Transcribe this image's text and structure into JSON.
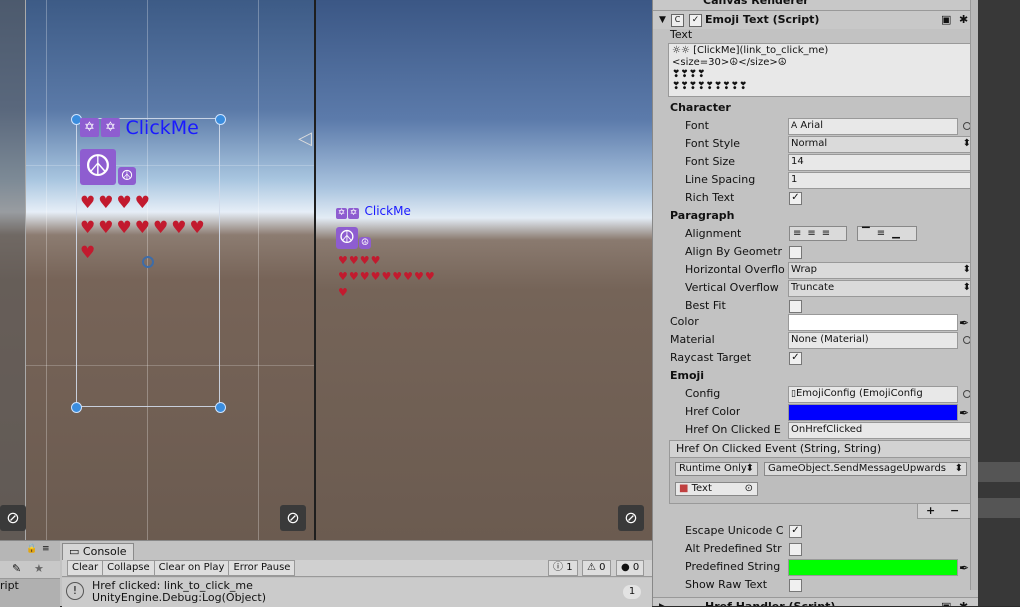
{
  "scene": {
    "click_me": "ClickMe",
    "star_glyph": "✡",
    "peace_glyph": "☮",
    "heart_rows": [
      "♥♥♥♥",
      "♥♥♥♥♥♥♥",
      "♥"
    ]
  },
  "game": {
    "click_me": "ClickMe",
    "star_glyph": "✡",
    "peace_glyph": "☮",
    "heart_rows": [
      "♥♥♥♥",
      "♥♥♥♥♥♥♥♥♥",
      "♥"
    ]
  },
  "console": {
    "tab_label": "Console",
    "script_label": "ript",
    "buttons": [
      "Clear",
      "Collapse",
      "Clear on Play",
      "Error Pause"
    ],
    "info_count": "1",
    "warn_count": "0",
    "error_count": "0",
    "log_line1": "Href clicked: link_to_click_me",
    "log_line2": "UnityEngine.Debug:Log(Object)",
    "log_count": "1"
  },
  "inspector": {
    "header_top": "Canvas Renderer",
    "component_title": "Emoji Text (Script)",
    "text_label": "Text",
    "text_lines": [
      "☼☼ [ClickMe](link_to_click_me)",
      "<size=30>☮</size>☮",
      "❣❣❣❣",
      "❣❣❣❣❣❣❣❣❣"
    ],
    "character_header": "Character",
    "font_label": "Font",
    "font_value": "Arial",
    "font_style_label": "Font Style",
    "font_style_value": "Normal",
    "font_size_label": "Font Size",
    "font_size_value": "14",
    "line_spacing_label": "Line Spacing",
    "line_spacing_value": "1",
    "rich_text_label": "Rich Text",
    "paragraph_header": "Paragraph",
    "alignment_label": "Alignment",
    "align_by_geometry_label": "Align By Geometr",
    "horizontal_overflow_label": "Horizontal Overflo",
    "horizontal_overflow_value": "Wrap",
    "vertical_overflow_label": "Vertical Overflow",
    "vertical_overflow_value": "Truncate",
    "best_fit_label": "Best Fit",
    "color_label": "Color",
    "material_label": "Material",
    "material_value": "None (Material)",
    "raycast_label": "Raycast Target",
    "emoji_header": "Emoji",
    "config_label": "Config",
    "config_value": "EmojiConfig (EmojiConfig",
    "href_color_label": "Href Color",
    "href_clicked_label": "Href On Clicked E",
    "href_clicked_value": "OnHrefClicked",
    "event_header": "Href On Clicked Event (String, String)",
    "runtime_value": "Runtime Only",
    "function_value": "GameObject.SendMessageUpwards",
    "target_value": "Text",
    "add_label": "+",
    "remove_label": "−",
    "escape_label": "Escape Unicode C",
    "alt_label": "Alt Predefined Str",
    "predefined_label": "Predefined String",
    "show_raw_label": "Show Raw Text",
    "footer_title": "Href Handler (Script)"
  },
  "colors": {
    "color_field": "#ffffff",
    "href_color": "#0000ff",
    "predefined_color": "#00ff00",
    "emoji_bg": "#8e5dd0",
    "link_blue": "#1a1aff",
    "heart_red": "#c21a2e"
  }
}
